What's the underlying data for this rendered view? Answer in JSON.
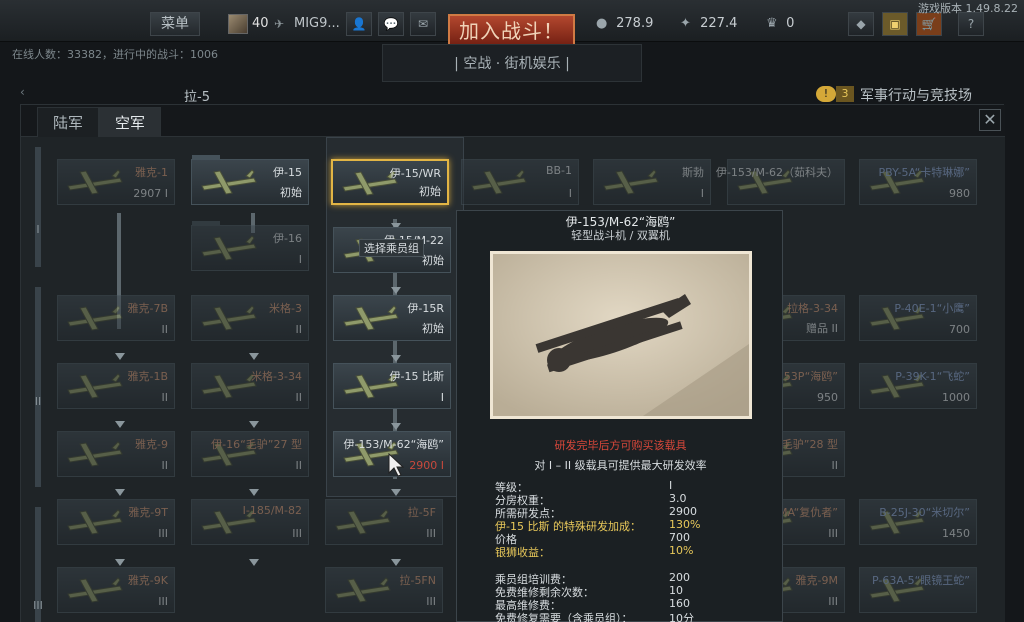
{
  "topbar": {
    "menu_label": "菜单",
    "player_level": "40",
    "player_name": "MIG9...",
    "join_label": "加入战斗！",
    "game_mode": "| 空战 · 街机娱乐 |",
    "silver_lions": "278.9",
    "research_points": "227.4",
    "golden_eagles": "0",
    "version": "游戏版本 1.49.8.22",
    "help_label": "?"
  },
  "online": "在线人数：33382，进行中的战斗：1006",
  "research_bar": {
    "vehicle_name": "拉-5",
    "ops_count": "3",
    "ops_label": "军事行动与竞技场"
  },
  "tabs": {
    "army": "陆军",
    "air": "空军"
  },
  "ranks": [
    "I",
    "II",
    "III"
  ],
  "crew_tooltip": "选择乘员组",
  "vehicles": [
    {
      "name": "雅克-1",
      "status": "2907 I",
      "style": "orange"
    },
    {
      "name": "伊-15",
      "status": "初始",
      "style": ""
    },
    {
      "name": "伊-16",
      "status": "I",
      "style": ""
    },
    {
      "name": "伊-15/WR",
      "status": "初始",
      "style": ""
    },
    {
      "name": "伊-15/M-22",
      "status": "初始",
      "style": ""
    },
    {
      "name": "伊-15R",
      "status": "初始",
      "style": ""
    },
    {
      "name": "伊-15 比斯",
      "status": "I",
      "style": ""
    },
    {
      "name": "伊-153/M-62“海鸥”",
      "status": "2900 I",
      "style": ""
    },
    {
      "name": "BB-1",
      "status": "I",
      "style": ""
    },
    {
      "name": "斯勃",
      "status": "I",
      "style": ""
    },
    {
      "name": "伊-153/M-62（茹科夫）",
      "status": "",
      "style": ""
    },
    {
      "name": "PBY-5A“卡特琳娜”",
      "status": "980",
      "style": "blue"
    },
    {
      "name": "雅克-7B",
      "status": "II",
      "style": "orange"
    },
    {
      "name": "米格-3",
      "status": "II",
      "style": "orange"
    },
    {
      "name": "拉格-3-34",
      "status": "赠品 II",
      "style": "orange"
    },
    {
      "name": "P-40E-1“小鹰”",
      "status": "700",
      "style": "blue"
    },
    {
      "name": "雅克-1B",
      "status": "II",
      "style": "orange"
    },
    {
      "name": "米格-3-34",
      "status": "II",
      "style": "orange"
    },
    {
      "name": "伊-153P“海鸥”",
      "status": "950",
      "style": "orange"
    },
    {
      "name": "P-39K-1“飞蛇”",
      "status": "1000",
      "style": "blue"
    },
    {
      "name": "雅克-9",
      "status": "II",
      "style": "orange"
    },
    {
      "name": "伊-16“毛驴”27 型",
      "status": "II",
      "style": "orange"
    },
    {
      "name": "伊-16“毛驴”28 型",
      "status": "II",
      "style": "orange"
    },
    {
      "name": "雅克-9T",
      "status": "III",
      "style": "orange"
    },
    {
      "name": "I-185/M-82",
      "status": "III",
      "style": "orange"
    },
    {
      "name": "拉-5F",
      "status": "III",
      "style": "orange"
    },
    {
      "name": "TIS MA“复仇者”",
      "status": "III",
      "style": "orange"
    },
    {
      "name": "B-25J-30“米切尔”",
      "status": "1450",
      "style": "blue"
    },
    {
      "name": "雅克-9K",
      "status": "III",
      "style": "orange"
    },
    {
      "name": "拉-5FN",
      "status": "III",
      "style": "orange"
    },
    {
      "name": "雅克-9M",
      "status": "III",
      "style": "orange"
    },
    {
      "name": "P-63A-5“眼镜王蛇”",
      "status": "",
      "style": "blue"
    }
  ],
  "tooltip": {
    "title": "伊-153/M-62“海鸥”",
    "subtitle": "轻型战斗机 / 双翼机",
    "warning": "研发完毕后方可购买该载具",
    "efficiency": "对 I – II 级载具可提供最大研发效率",
    "rows": [
      {
        "k": "等级：",
        "v": "I"
      },
      {
        "k": "分房权重：",
        "v": "3.0"
      },
      {
        "k": "所需研发点：",
        "v": "2900"
      },
      {
        "k": "伊-15 比斯 的特殊研发加成：",
        "v": "130%"
      },
      {
        "k": "价格",
        "v": "700"
      },
      {
        "k": "银狮收益：",
        "v": "10%"
      },
      {
        "k": "乘员组培训费：",
        "v": "200"
      },
      {
        "k": "免费维修剩余次数：",
        "v": "10"
      },
      {
        "k": "最高维修费：",
        "v": "160"
      },
      {
        "k": "免费修复需要（含乘员组）：",
        "v": "10分"
      }
    ]
  }
}
